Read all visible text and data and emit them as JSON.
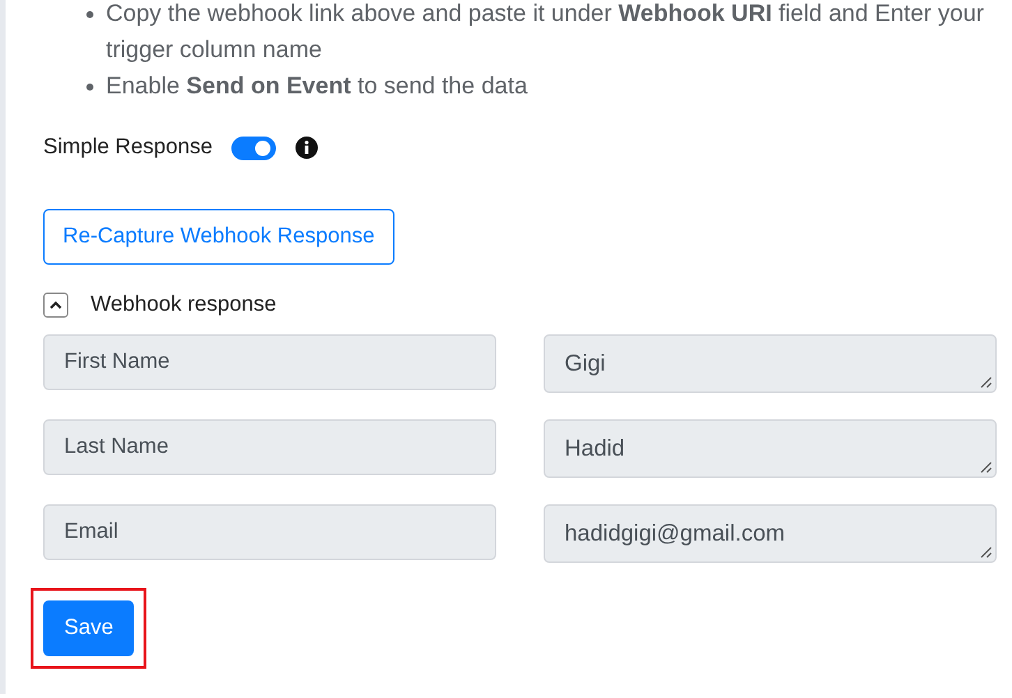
{
  "instructions": [
    "Copy the webhook link above and paste it under **Webhook URI** field and Enter your trigger column name",
    "Enable **Send on Event** to send the data"
  ],
  "simple_response": {
    "label": "Simple Response",
    "on": true
  },
  "recapture_button": "Re-Capture Webhook Response",
  "webhook_response": {
    "label": "Webhook response",
    "expanded": true,
    "fields": [
      {
        "key": "First Name",
        "value": "Gigi"
      },
      {
        "key": "Last Name",
        "value": "Hadid"
      },
      {
        "key": "Email",
        "value": "hadidgigi@gmail.com"
      }
    ]
  },
  "save_button": {
    "label": "Save",
    "highlighted": true
  }
}
